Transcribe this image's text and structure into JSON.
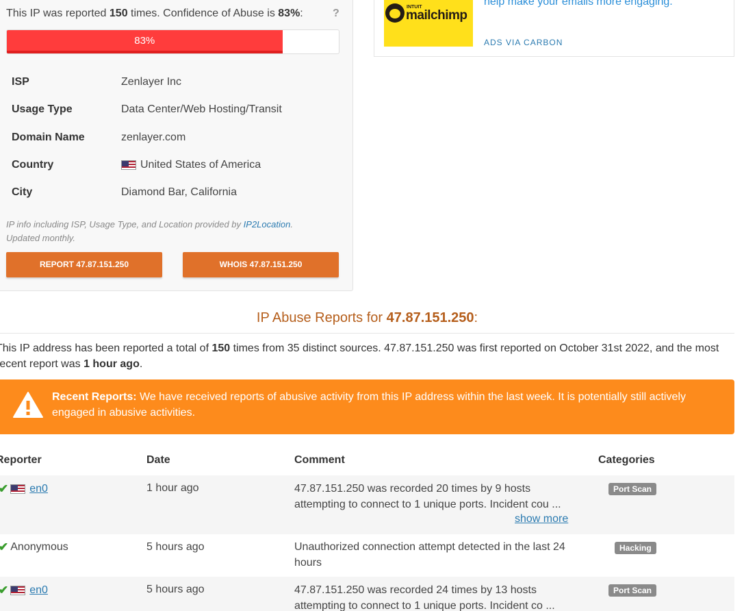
{
  "confidence": {
    "text_prefix": "This IP was reported ",
    "count": "150",
    "text_mid": " times. Confidence of Abuse is ",
    "percent": "83%",
    "text_suffix": ":",
    "help": "?",
    "progress_value": 83,
    "progress_label": "83%"
  },
  "info": {
    "rows": [
      {
        "key": "ISP",
        "value": "Zenlayer Inc"
      },
      {
        "key": "Usage Type",
        "value": "Data Center/Web Hosting/Transit"
      },
      {
        "key": "Domain Name",
        "value": "zenlayer.com"
      },
      {
        "key": "Country",
        "value": "United States of America",
        "flag": "us-flag"
      },
      {
        "key": "City",
        "value": "Diamond Bar, California"
      }
    ],
    "note_prefix": "IP info including ISP, Usage Type, and Location provided by ",
    "note_link": "IP2Location",
    "note_suffix": ". Updated monthly."
  },
  "buttons": {
    "report": "REPORT 47.87.151.250",
    "whois": "WHOIS 47.87.151.250"
  },
  "ad": {
    "logo_small": "INTUIT",
    "logo_brand": "mailchimp",
    "text": "help make your emails more engaging.",
    "via": "ADS VIA CARBON"
  },
  "reports": {
    "title_prefix": "IP Abuse Reports for ",
    "ip": "47.87.151.250",
    "title_suffix": ":",
    "summary_a": "This IP address has been reported a total of ",
    "summary_count": "150",
    "summary_b": " times from 35 distinct sources. 47.87.151.250 was first reported on October 31st 2022, and the most recent report was ",
    "summary_recent": "1 hour ago",
    "summary_c": "."
  },
  "alert": {
    "title": "Recent Reports:",
    "text": " We have received reports of abusive activity from this IP address within the last week. It is potentially still actively engaged in abusive activities.",
    "color": "#fd8b1c"
  },
  "table": {
    "headers": [
      "Reporter",
      "Date",
      "Comment",
      "Categories"
    ],
    "rows": [
      {
        "reporter": "en0",
        "reporter_flag": true,
        "date": "1 hour ago",
        "comment": "47.87.151.250 was recorded 20 times by 9 hosts attempting to connect to 1 unique ports. Incident cou ...",
        "show_more": "show more",
        "category": "Port Scan"
      },
      {
        "reporter": "Anonymous",
        "reporter_flag": false,
        "date": "5 hours ago",
        "comment": "Unauthorized connection attempt detected in the last 24 hours",
        "category": "Hacking"
      },
      {
        "reporter": "en0",
        "reporter_flag": true,
        "date": "5 hours ago",
        "comment": "47.87.151.250 was recorded 24 times by 13 hosts attempting to connect to 1 unique ports. Incident co ...",
        "category": "Port Scan"
      }
    ]
  }
}
